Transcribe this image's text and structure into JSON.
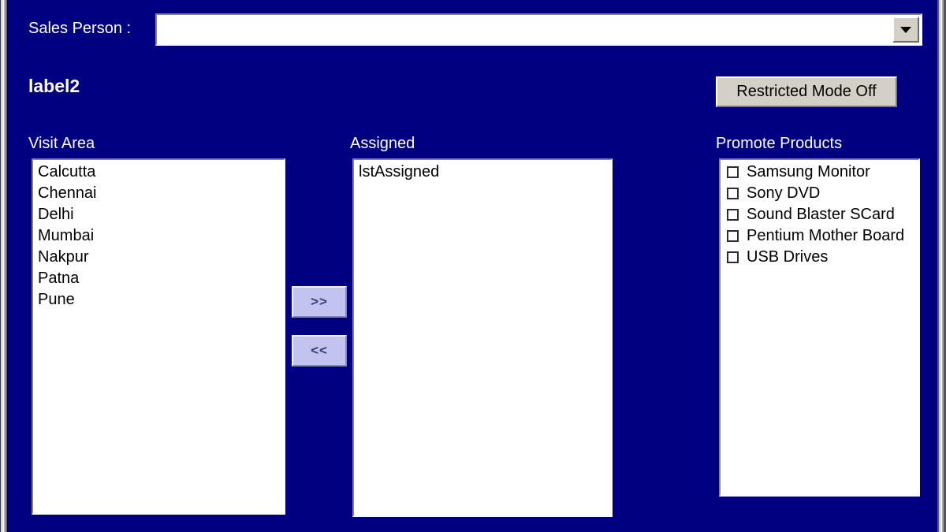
{
  "colors": {
    "form_background": "#000080",
    "listbox_background": "#ffffff",
    "button_face": "#d4d0c8",
    "transfer_button_face": "#c3c3ef",
    "label_text": "#ffffff",
    "item_text": "#000000"
  },
  "top_bar": {
    "sales_person_label": "Sales Person :",
    "sales_person_value": "",
    "sales_person_placeholder": "",
    "dropdown_icon": "chevron-down-icon"
  },
  "header": {
    "label2": "label2",
    "restricted_mode_button": "Restricted Mode Off"
  },
  "visit_area": {
    "header": "Visit Area",
    "items": [
      "Calcutta",
      "Chennai",
      "Delhi",
      "Mumbai",
      "Nakpur",
      "Patna",
      "Pune"
    ]
  },
  "transfer": {
    "assign_label": ">>",
    "unassign_label": "<<"
  },
  "assigned": {
    "header": "Assigned",
    "items": [
      "lstAssigned"
    ]
  },
  "promote_products": {
    "header": "Promote Products",
    "items": [
      {
        "label": "Samsung Monitor",
        "checked": false
      },
      {
        "label": "Sony DVD",
        "checked": false
      },
      {
        "label": "Sound Blaster SCard",
        "checked": false
      },
      {
        "label": "Pentium Mother Board",
        "checked": false
      },
      {
        "label": "USB Drives",
        "checked": false
      }
    ]
  }
}
